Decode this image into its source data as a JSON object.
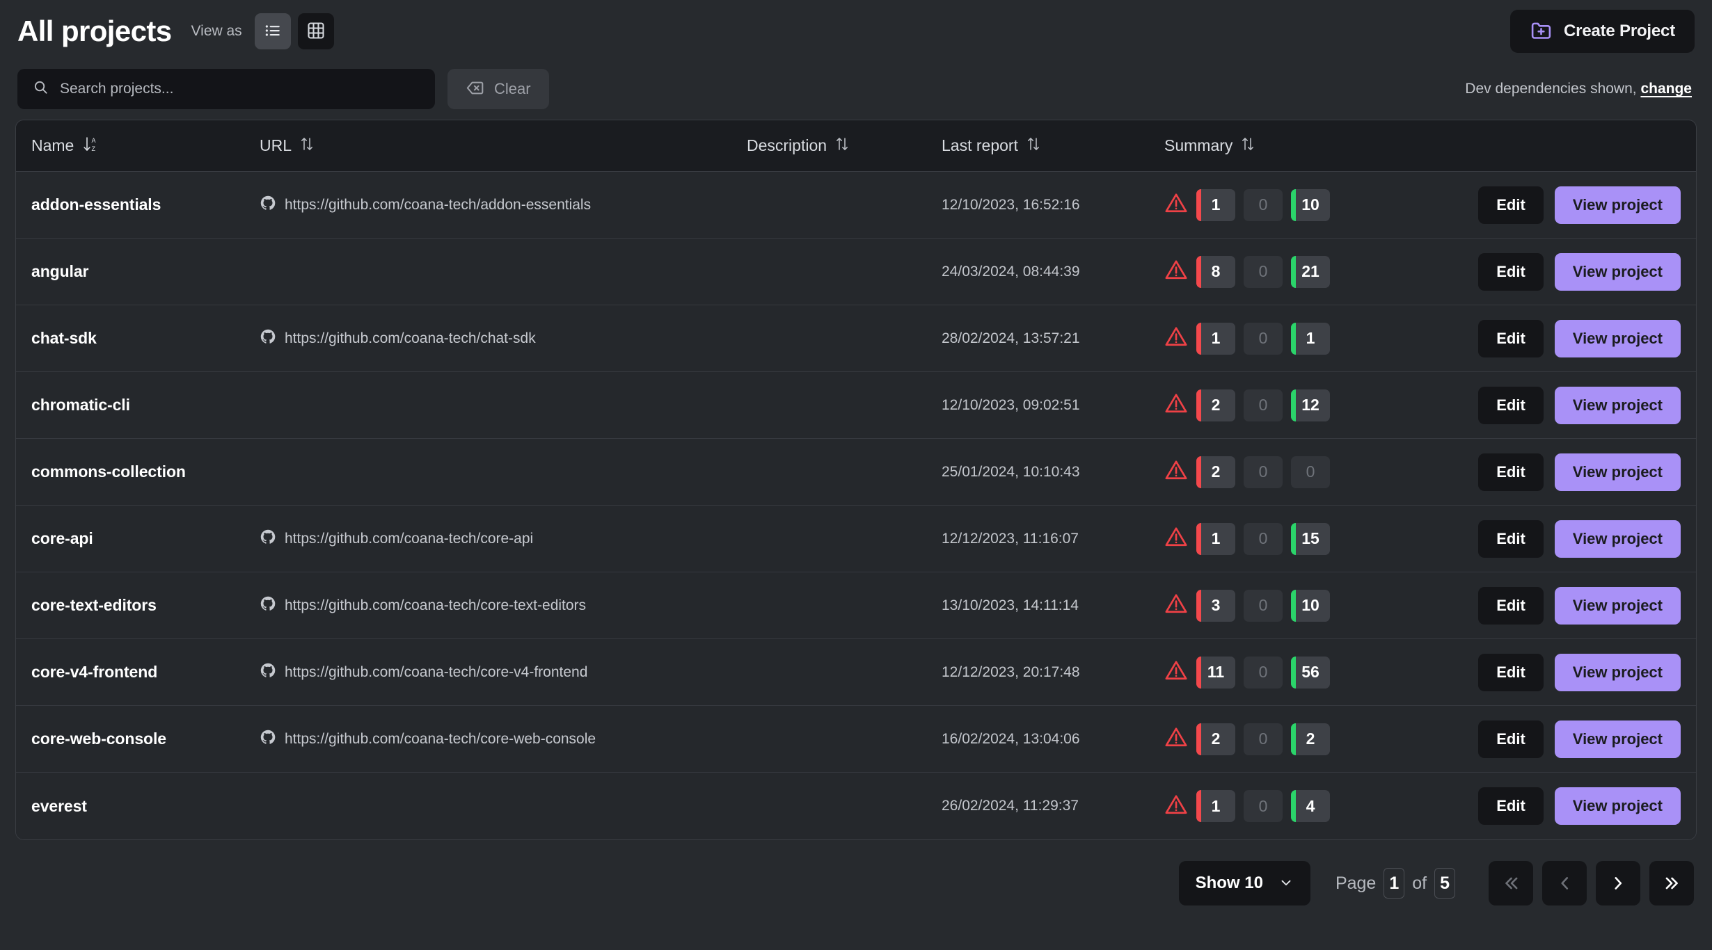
{
  "header": {
    "title": "All projects",
    "view_as_label": "View as",
    "view_list_icon": "list-view-icon",
    "view_grid_icon": "grid-view-icon",
    "view_selected": "list",
    "create_button": {
      "label": "Create Project",
      "icon": "folder-plus-icon"
    }
  },
  "search": {
    "placeholder": "Search projects...",
    "value": "",
    "icon": "search-icon",
    "clear_label": "Clear",
    "clear_icon": "backspace-icon"
  },
  "dev_notice": {
    "text": "Dev dependencies shown,",
    "link": "change"
  },
  "table": {
    "columns": [
      {
        "label": "Name",
        "sort_icon": "sort-a-z-icon",
        "sorted": true
      },
      {
        "label": "URL",
        "sort_icon": "sort-updown-icon",
        "sorted": false
      },
      {
        "label": "Description",
        "sort_icon": "sort-updown-icon",
        "sorted": false
      },
      {
        "label": "Last report",
        "sort_icon": "sort-updown-icon",
        "sorted": false
      },
      {
        "label": "Summary",
        "sort_icon": "sort-updown-icon",
        "sorted": false
      }
    ],
    "row_actions": {
      "edit_label": "Edit",
      "view_label": "View project"
    },
    "rows": [
      {
        "name": "addon-essentials",
        "url": "https://github.com/coana-tech/addon-essentials",
        "url_icon": "github-icon",
        "description": "",
        "last_report": "12/10/2023, 16:52:16",
        "summary": {
          "warning_icon": "warning-triangle-icon",
          "critical": "1",
          "medium": "0",
          "low": "10"
        }
      },
      {
        "name": "angular",
        "url": "",
        "url_icon": "",
        "description": "",
        "last_report": "24/03/2024, 08:44:39",
        "summary": {
          "warning_icon": "warning-triangle-icon",
          "critical": "8",
          "medium": "0",
          "low": "21"
        }
      },
      {
        "name": "chat-sdk",
        "url": "https://github.com/coana-tech/chat-sdk",
        "url_icon": "github-icon",
        "description": "",
        "last_report": "28/02/2024, 13:57:21",
        "summary": {
          "warning_icon": "warning-triangle-icon",
          "critical": "1",
          "medium": "0",
          "low": "1"
        }
      },
      {
        "name": "chromatic-cli",
        "url": "",
        "url_icon": "",
        "description": "",
        "last_report": "12/10/2023, 09:02:51",
        "summary": {
          "warning_icon": "warning-triangle-icon",
          "critical": "2",
          "medium": "0",
          "low": "12"
        }
      },
      {
        "name": "commons-collection",
        "url": "",
        "url_icon": "",
        "description": "",
        "last_report": "25/01/2024, 10:10:43",
        "summary": {
          "warning_icon": "warning-triangle-icon",
          "critical": "2",
          "medium": "0",
          "low": "0"
        }
      },
      {
        "name": "core-api",
        "url": "https://github.com/coana-tech/core-api",
        "url_icon": "github-icon",
        "description": "",
        "last_report": "12/12/2023, 11:16:07",
        "summary": {
          "warning_icon": "warning-triangle-icon",
          "critical": "1",
          "medium": "0",
          "low": "15"
        }
      },
      {
        "name": "core-text-editors",
        "url": "https://github.com/coana-tech/core-text-editors",
        "url_icon": "github-icon",
        "description": "",
        "last_report": "13/10/2023, 14:11:14",
        "summary": {
          "warning_icon": "warning-triangle-icon",
          "critical": "3",
          "medium": "0",
          "low": "10"
        }
      },
      {
        "name": "core-v4-frontend",
        "url": "https://github.com/coana-tech/core-v4-frontend",
        "url_icon": "github-icon",
        "description": "",
        "last_report": "12/12/2023, 20:17:48",
        "summary": {
          "warning_icon": "warning-triangle-icon",
          "critical": "11",
          "medium": "0",
          "low": "56"
        }
      },
      {
        "name": "core-web-console",
        "url": "https://github.com/coana-tech/core-web-console",
        "url_icon": "github-icon",
        "description": "",
        "last_report": "16/02/2024, 13:04:06",
        "summary": {
          "warning_icon": "warning-triangle-icon",
          "critical": "2",
          "medium": "0",
          "low": "2"
        }
      },
      {
        "name": "everest",
        "url": "",
        "url_icon": "",
        "description": "",
        "last_report": "26/02/2024, 11:29:37",
        "summary": {
          "warning_icon": "warning-triangle-icon",
          "critical": "1",
          "medium": "0",
          "low": "4"
        }
      }
    ]
  },
  "pagination": {
    "show_label": "Show 10",
    "show_chevron_icon": "chevron-down-icon",
    "page_word": "Page",
    "current_page": "1",
    "of_word": "of",
    "total_pages": "5",
    "first_icon": "chevrons-left-icon",
    "prev_icon": "chevron-left-icon",
    "next_icon": "chevron-right-icon",
    "last_icon": "chevrons-right-icon",
    "first_enabled": false,
    "prev_enabled": false,
    "next_enabled": true,
    "last_enabled": true
  },
  "colors": {
    "background": "#272a2e",
    "table_row": "#25282c",
    "table_header": "#1a1c20",
    "accent_purple": "#a991f7",
    "critical_red": "#f4484c",
    "low_green": "#2bd46a",
    "dark_button": "#141518"
  }
}
